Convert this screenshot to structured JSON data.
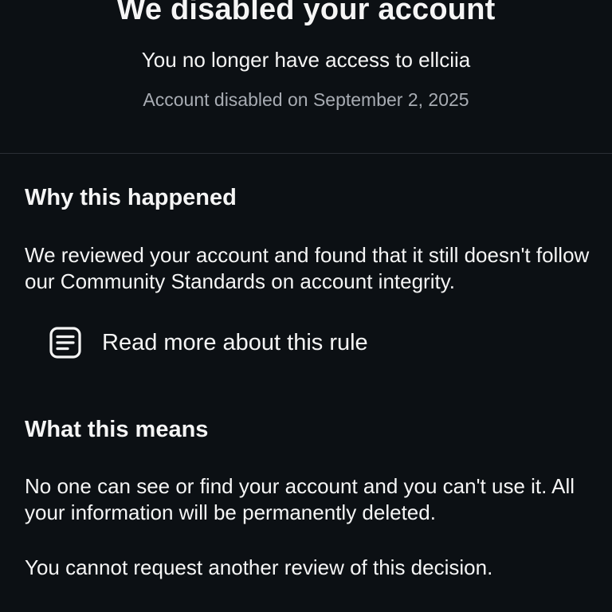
{
  "header": {
    "title": "We disabled your account",
    "subtitle": "You no longer have access to ellciia",
    "disabled_date": "Account disabled on September 2, 2025"
  },
  "why": {
    "heading": "Why this happened",
    "body": "We reviewed your account and found that it still doesn't follow our Community Standards on account integrity.",
    "link": {
      "icon": "document-icon",
      "label": "Read more about this rule"
    }
  },
  "means": {
    "heading": "What this means",
    "body": "No one can see or find your account and you can't use it. All your information will be permanently deleted.",
    "note": "You cannot request another review of this decision."
  },
  "colors": {
    "background": "#0c1014",
    "text_primary": "#f5f5f5",
    "text_secondary": "#a8acb3",
    "divider": "#2a2f35"
  }
}
